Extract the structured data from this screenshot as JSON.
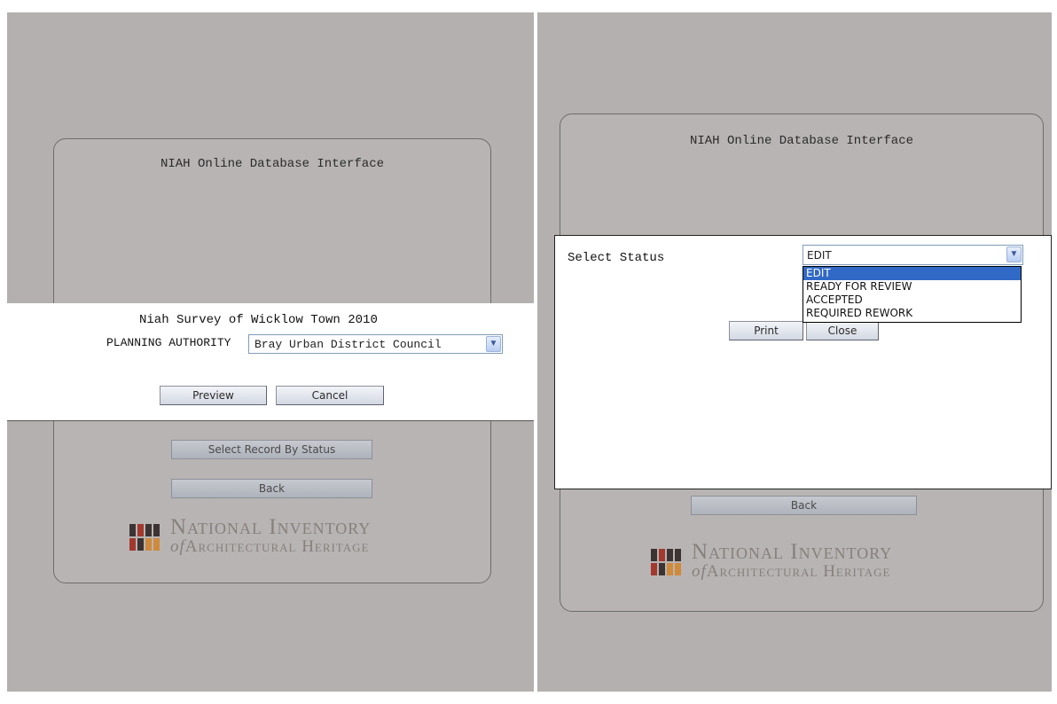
{
  "left": {
    "title": "NIAH Online Database Interface",
    "modal": {
      "heading": "Niah Survey of Wicklow Town 2010",
      "field_label": "PLANNING AUTHORITY",
      "field_value": "Bray Urban District Council",
      "preview_label": "Preview",
      "cancel_label": "Cancel"
    },
    "select_by_status_label": "Select Record By Status",
    "back_label": "Back"
  },
  "right": {
    "title": "NIAH Online Database Interface",
    "modal": {
      "status_label": "Select Status",
      "status_value": "EDIT",
      "status_options": [
        "EDIT",
        "READY FOR REVIEW",
        "ACCEPTED",
        "REQUIRED REWORK"
      ],
      "print_label": "Print",
      "close_label": "Close"
    },
    "back_label": "Back"
  },
  "logo": {
    "line1": "National Inventory",
    "line2_italic": "of",
    "line2": "Architectural Heritage"
  },
  "colors": {
    "panel_background": "#b3b0af",
    "logo_red": "#a3382d",
    "logo_dark": "#3b3433",
    "logo_orange": "#d08a3c",
    "dropdown_highlight": "#3169c6"
  },
  "icons": {
    "dropdown_arrow": "chevron-down-icon",
    "logo_mark": "niah-logo-icon"
  }
}
